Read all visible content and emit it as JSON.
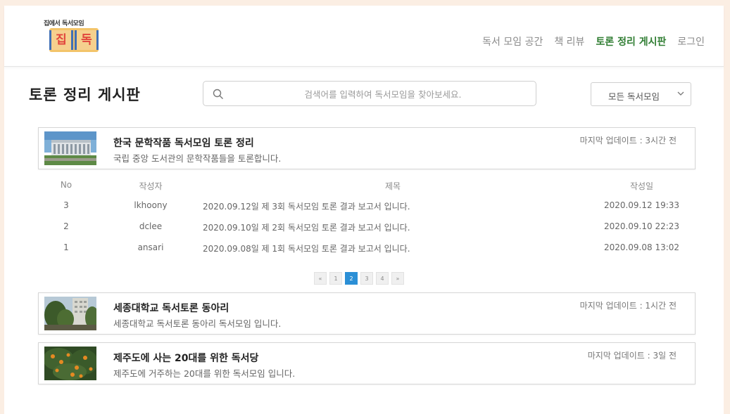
{
  "header": {
    "logo_top": "집에서 독서모임",
    "logo_chars": [
      "집",
      "독"
    ],
    "nav": [
      {
        "label": "독서 모임 공간",
        "active": false
      },
      {
        "label": "책 리뷰",
        "active": false
      },
      {
        "label": "토론 정리 게시판",
        "active": true
      },
      {
        "label": "로그인",
        "active": false
      }
    ]
  },
  "page_title": "토론 정리 게시판",
  "search": {
    "placeholder": "검색어를 입력하여 독서모임을 찾아보세요."
  },
  "filter": {
    "selected": "모든 독서모임"
  },
  "groups": [
    {
      "title": "한국 문학작품 독서모임 토론 정리",
      "desc": "국립 중앙 도서관의 문학작품들을 토론합니다.",
      "updated": "마지막 업데이트 : 3시간 전",
      "thumb": "library-building"
    },
    {
      "title": "세종대학교 독서토론 동아리",
      "desc": "세종대학교 독서토론 동아리 독서모임 입니다.",
      "updated": "마지막 업데이트 : 1시간 전",
      "thumb": "campus-trees"
    },
    {
      "title": "제주도에 사는 20대를 위한 독서당",
      "desc": "제주도에 거주하는 20대를 위한 독서모임 입니다.",
      "updated": "마지막 업데이트 : 3일 전",
      "thumb": "tangerine-tree"
    }
  ],
  "table": {
    "headers": {
      "no": "No",
      "author": "작성자",
      "title": "제목",
      "date": "작성일"
    },
    "rows": [
      {
        "no": "3",
        "author": "lkhoony",
        "title": "2020.09.12일 제 3회 독서모임 토론 결과 보고서 입니다.",
        "date": "2020.09.12 19:33"
      },
      {
        "no": "2",
        "author": "dclee",
        "title": "2020.09.10일 제 2회 독서모임 토론 결과 보고서 입니다.",
        "date": "2020.09.10 22:23"
      },
      {
        "no": "1",
        "author": "ansari",
        "title": "2020.09.08일 제 1회 독서모임 토론 결과 보고서 입니다.",
        "date": "2020.09.08 13:02"
      }
    ]
  },
  "pagination": {
    "prev": "«",
    "next": "»",
    "pages": [
      "1",
      "2",
      "3",
      "4"
    ],
    "current": "2"
  },
  "colors": {
    "active_nav": "#2f7d32",
    "page_active": "#2b8fd6",
    "backdrop": "#fbeee3"
  }
}
